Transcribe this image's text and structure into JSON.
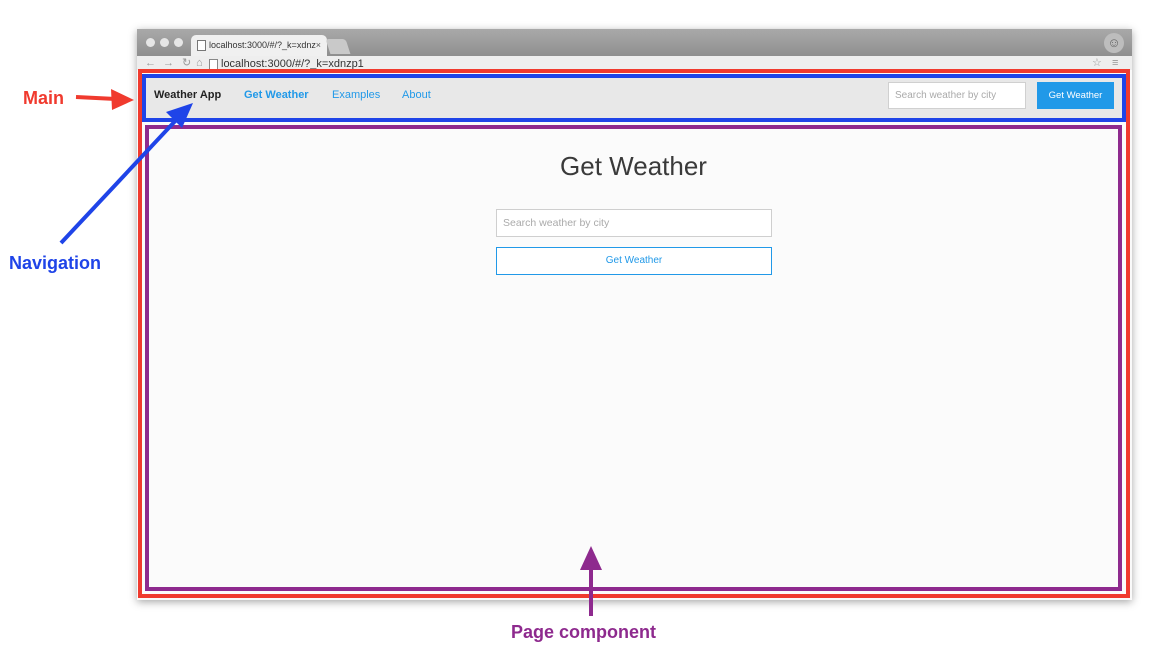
{
  "annotations": {
    "main": "Main",
    "navigation": "Navigation",
    "page_component": "Page component"
  },
  "browser": {
    "tab_title": "localhost:3000/#/?_k=xdnz",
    "tab_close": "×",
    "url": "localhost:3000/#/?_k=xdnzp1"
  },
  "nav": {
    "brand": "Weather App",
    "links": [
      "Get Weather",
      "Examples",
      "About"
    ],
    "search_placeholder": "Search weather by city",
    "button_label": "Get Weather"
  },
  "page": {
    "title": "Get Weather",
    "search_placeholder": "Search weather by city",
    "button_label": "Get Weather"
  },
  "colors": {
    "main_outline": "#f03a2e",
    "navigation_outline": "#1f44e8",
    "page_outline": "#8e2a8e",
    "accent": "#2199e8"
  }
}
